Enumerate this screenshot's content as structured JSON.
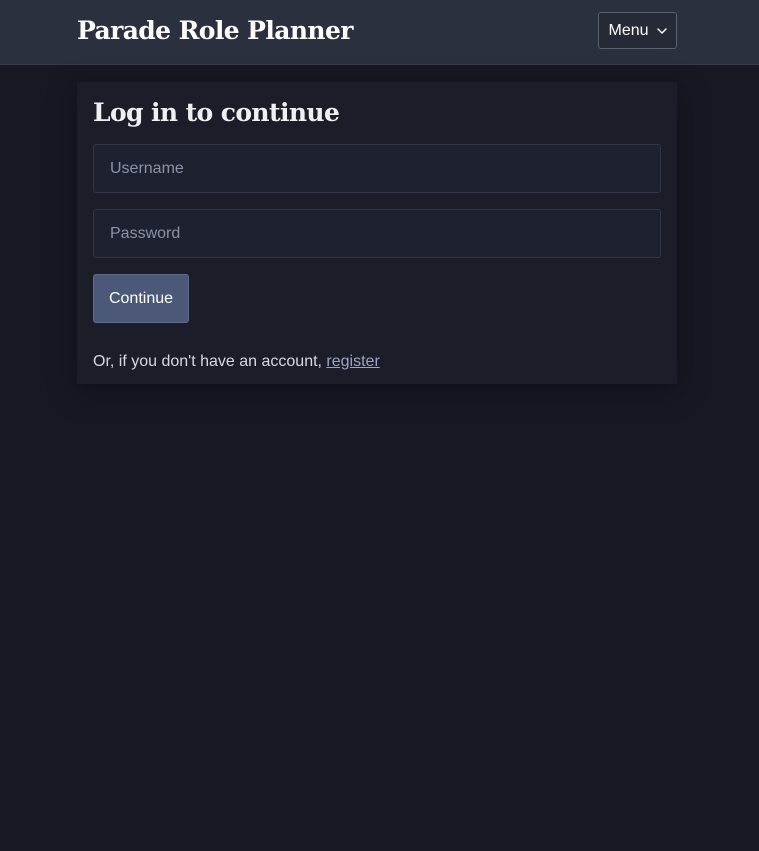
{
  "header": {
    "title": "Parade Role Planner",
    "menu_label": "Menu",
    "menu_icon": "chevron-down-icon"
  },
  "login": {
    "heading": "Log in to continue",
    "username": {
      "placeholder": "Username",
      "value": ""
    },
    "password": {
      "placeholder": "Password",
      "value": ""
    },
    "submit_label": "Continue",
    "register_prefix": "Or, if you don't have an account, ",
    "register_link": "register"
  },
  "colors": {
    "background": "#161922",
    "header_bg": "#2b303f",
    "card_bg": "#1b1e29",
    "button_bg": "#4c5878",
    "link": "#9ba5c4"
  }
}
